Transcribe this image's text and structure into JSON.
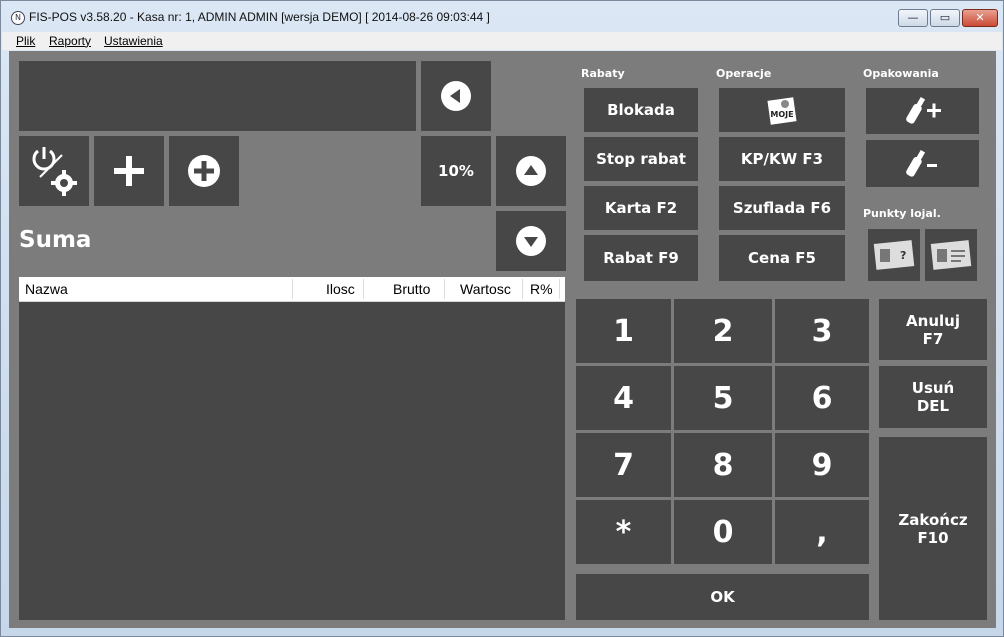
{
  "window": {
    "title": "FIS-POS v3.58.20 - Kasa nr: 1, ADMIN ADMIN [wersja DEMO]  [ 2014-08-26 09:03:44 ]",
    "app_icon": "fis-pos-logo-icon",
    "buttons": {
      "minimize": "—",
      "maximize": "▭",
      "close": "✕"
    }
  },
  "menu": [
    "Plik",
    "Raporty",
    "Ustawienia"
  ],
  "left": {
    "display_value": "",
    "suma_label": "Suma",
    "discount_button": "10%",
    "table": {
      "columns": [
        "Nazwa",
        "Ilosc",
        "Brutto",
        "Wartosc",
        "R%"
      ],
      "rows": []
    }
  },
  "groups": {
    "rabaty": "Rabaty",
    "operacje": "Operacje",
    "opakowania": "Opakowania",
    "punkty": "Punkty lojal."
  },
  "rabaty_buttons": [
    "Blokada",
    "Stop rabat",
    "Karta F2",
    "Rabat F9"
  ],
  "operacje_buttons": [
    "",
    "KP/KW F3",
    "Szuflada F6",
    "Cena F5"
  ],
  "moje_rachunki_icon_text": "MOJE",
  "keypad": [
    "1",
    "2",
    "3",
    "4",
    "5",
    "6",
    "7",
    "8",
    "9",
    "*",
    "0",
    ","
  ],
  "ok_label": "OK",
  "side_buttons": {
    "anuluj": "Anuluj\nF7",
    "usun": "Usuń\nDEL",
    "zakoncz": "Zakończ\nF10"
  },
  "colors": {
    "panel_bg": "#7c7c7c",
    "tile_bg": "#474747",
    "text": "#ffffff"
  }
}
